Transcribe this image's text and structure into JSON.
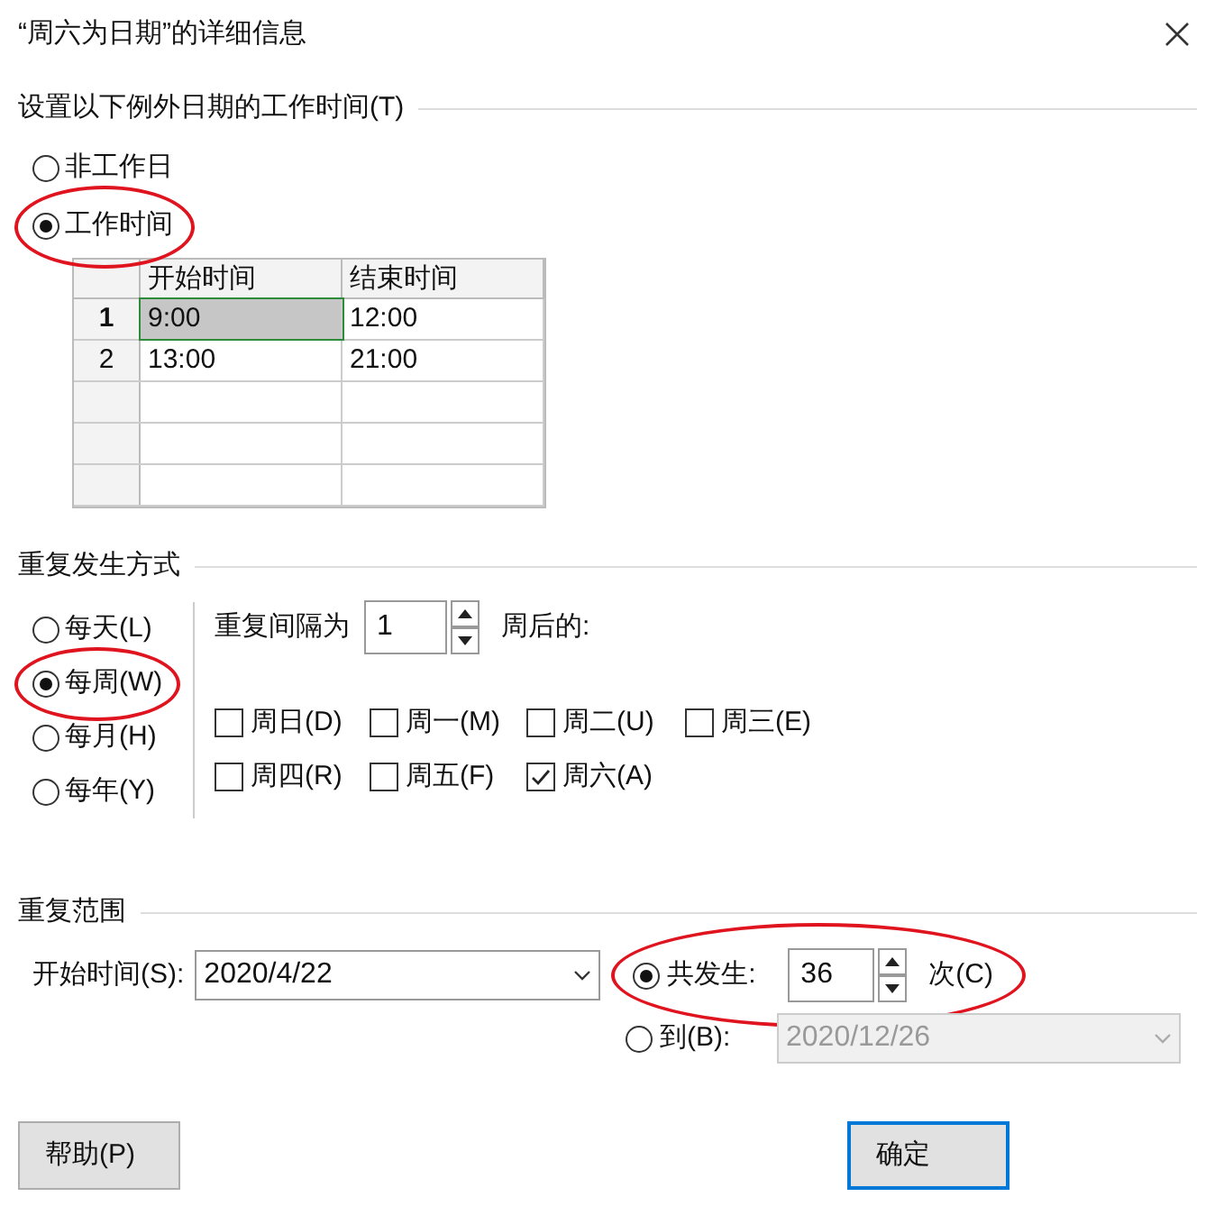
{
  "window": {
    "title": "“周六为日期”的详细信息"
  },
  "work_time": {
    "label": "设置以下例外日期的工作时间(T)",
    "options": [
      {
        "label": "非工作日",
        "selected": false,
        "circled": false
      },
      {
        "label": "工作时间",
        "selected": true,
        "circled": true
      }
    ],
    "table": {
      "columns": [
        "开始时间",
        "结束时间"
      ],
      "rows": [
        {
          "kind": "filled",
          "number": "1",
          "cells": [
            {
              "text": "9:00",
              "selected": true
            },
            {
              "text": "12:00",
              "selected": false
            }
          ]
        },
        {
          "kind": "filled",
          "number": "2",
          "cells": [
            {
              "text": "13:00",
              "selected": false
            },
            {
              "text": "21:00",
              "selected": false
            }
          ]
        },
        {
          "kind": "empty"
        },
        {
          "kind": "empty"
        },
        {
          "kind": "empty"
        }
      ]
    }
  },
  "recurrence": {
    "label": "重复发生方式",
    "options": [
      {
        "label": "每天(L)",
        "selected": false,
        "circled": false
      },
      {
        "label": "每周(W)",
        "selected": true,
        "circled": true
      },
      {
        "label": "每月(H)",
        "selected": false,
        "circled": false
      },
      {
        "label": "每年(Y)",
        "selected": false,
        "circled": false
      }
    ],
    "interval_label": "重复间隔为",
    "interval": "1",
    "interval_suffix": "周后的:",
    "days": [
      {
        "label": "周日(D)",
        "checked": false
      },
      {
        "label": "周一(M)",
        "checked": false
      },
      {
        "label": "周二(U)",
        "checked": false
      },
      {
        "label": "周三(E)",
        "checked": false
      },
      {
        "label": "周四(R)",
        "checked": false
      },
      {
        "label": "周五(F)",
        "checked": false
      },
      {
        "label": "周六(A)",
        "checked": true
      }
    ]
  },
  "range": {
    "label": "重复范围",
    "start_label": "开始时间(S):",
    "start": "2020/4/22",
    "end_options": [
      {
        "kind": "count",
        "label": "共发生:",
        "value": "36",
        "suffix": "次(C)",
        "selected": true,
        "circled": true
      },
      {
        "kind": "date",
        "label": "到(B):",
        "value": "2020/12/26",
        "selected": false,
        "circled": false
      }
    ]
  },
  "buttons": [
    "帮助(P)",
    "确定"
  ]
}
